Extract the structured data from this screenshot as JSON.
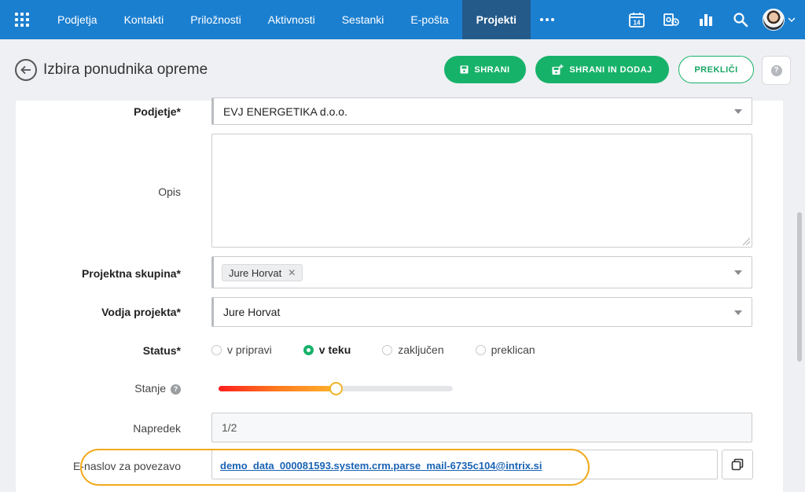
{
  "nav": {
    "items": [
      {
        "label": "Podjetja"
      },
      {
        "label": "Kontakti"
      },
      {
        "label": "Priložnosti"
      },
      {
        "label": "Aktivnosti"
      },
      {
        "label": "Sestanki"
      },
      {
        "label": "E-pošta"
      },
      {
        "label": "Projekti",
        "active": true
      }
    ],
    "calendar_day": "14"
  },
  "header": {
    "title": "Izbira ponudnika opreme",
    "save_label": "SHRANI",
    "save_add_label": "SHRANI IN DODAJ",
    "cancel_label": "PREKLIČI",
    "help_glyph": "?"
  },
  "form": {
    "company": {
      "label": "Podjetje*",
      "value": "EVJ ENERGETIKA d.o.o."
    },
    "description": {
      "label": "Opis",
      "value": ""
    },
    "project_group": {
      "label": "Projektna skupina*",
      "tags": [
        "Jure Horvat"
      ]
    },
    "project_lead": {
      "label": "Vodja projekta*",
      "value": "Jure Horvat"
    },
    "status": {
      "label": "Status*",
      "options": [
        "v pripravi",
        "v teku",
        "zaključen",
        "preklican"
      ],
      "selected": "v teku"
    },
    "state": {
      "label": "Stanje",
      "level_percent": 50
    },
    "progress": {
      "label": "Napredek",
      "value": "1/2"
    },
    "email": {
      "label": "E-naslov za povezavo",
      "value": "demo_data_000081593.system.crm.parse_mail-6735c104@intrix.si"
    }
  },
  "colors": {
    "nav_bg": "#1b7fd0",
    "nav_active": "#245a8a",
    "accent_green": "#17b26a",
    "highlight": "#f3a91b",
    "link": "#1a63b5"
  }
}
